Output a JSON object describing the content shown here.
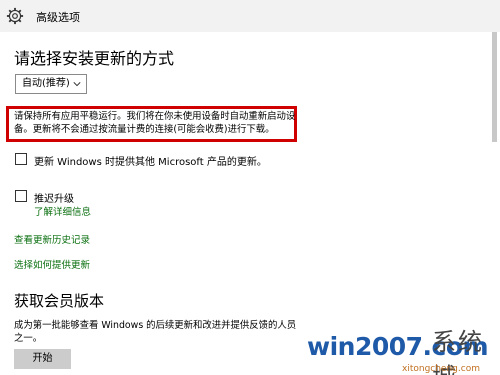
{
  "window": {
    "title": "高级选项"
  },
  "main": {
    "heading": "请选择安装更新的方式",
    "install_mode": {
      "selected": "自动(推荐)"
    },
    "highlight_text": "请保持所有应用平稳运行。我们将在你未使用设备时自动重新启动设备。更新将不会通过按流量计费的连接(可能会收费)进行下载。",
    "options": [
      {
        "label": "更新 Windows 时提供其他 Microsoft 产品的更新。",
        "checked": false
      },
      {
        "label": "推迟升级",
        "checked": false
      }
    ],
    "learn_more_link": "了解详细信息",
    "links": [
      "查看更新历史记录",
      "选择如何提供更新"
    ]
  },
  "insider": {
    "heading": "获取会员版本",
    "description": "成为第一批能够查看 Windows 的后续更新和改进并提供反馈的人员之一。",
    "start_label": "开始"
  },
  "watermark": {
    "main": "win2007.com",
    "cn": "系统城",
    "url": "xitongcheng.com"
  },
  "colors": {
    "link": "#0a6f0f",
    "highlight_border": "#d00000",
    "titlebar_bg": "#f2f2f2"
  }
}
